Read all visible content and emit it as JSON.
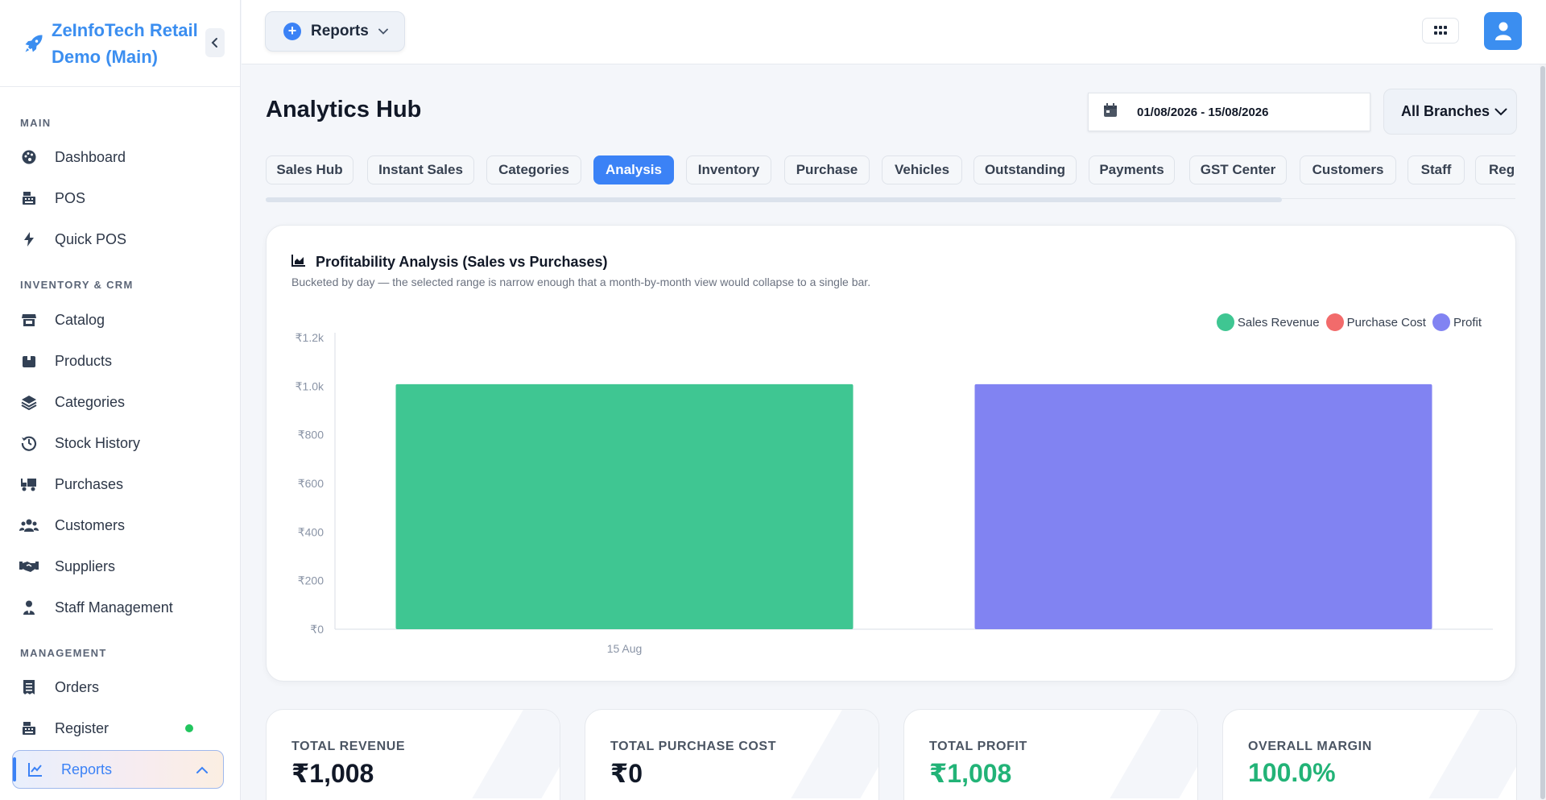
{
  "brand": {
    "name": "ZeInfoTech Retail Demo (Main)"
  },
  "sidebar": {
    "sections": [
      {
        "label": "MAIN",
        "items": [
          {
            "label": "Dashboard",
            "icon": "palette-icon"
          },
          {
            "label": "POS",
            "icon": "cash-register-icon"
          },
          {
            "label": "Quick POS",
            "icon": "bolt-icon"
          }
        ]
      },
      {
        "label": "INVENTORY & CRM",
        "items": [
          {
            "label": "Catalog",
            "icon": "store-icon"
          },
          {
            "label": "Products",
            "icon": "box-icon"
          },
          {
            "label": "Categories",
            "icon": "layers-icon"
          },
          {
            "label": "Stock History",
            "icon": "history-icon"
          },
          {
            "label": "Purchases",
            "icon": "truck-icon"
          },
          {
            "label": "Customers",
            "icon": "users-icon"
          },
          {
            "label": "Suppliers",
            "icon": "handshake-icon"
          },
          {
            "label": "Staff Management",
            "icon": "user-tie-icon"
          }
        ]
      },
      {
        "label": "MANAGEMENT",
        "items": [
          {
            "label": "Orders",
            "icon": "receipt-icon"
          },
          {
            "label": "Register",
            "icon": "cash-register-icon"
          },
          {
            "label": "Reports",
            "icon": "chart-line-icon"
          }
        ]
      }
    ]
  },
  "topbar": {
    "reports_label": "Reports"
  },
  "page": {
    "title": "Analytics Hub",
    "date_range": "01/08/2026 - 15/08/2026",
    "branch": "All Branches"
  },
  "tabs": [
    "Sales Hub",
    "Instant Sales",
    "Categories",
    "Analysis",
    "Inventory",
    "Purchase",
    "Vehicles",
    "Outstanding",
    "Payments",
    "GST Center",
    "Customers",
    "Staff",
    "Regi"
  ],
  "active_tab": "Analysis",
  "chart": {
    "title": "Profitability Analysis (Sales vs Purchases)",
    "subtitle": "Bucketed by day — the selected range is narrow enough that a month-by-month view would collapse to a single bar."
  },
  "chart_data": {
    "type": "bar",
    "title": "Profitability Analysis (Sales vs Purchases)",
    "categories": [
      "15 Aug"
    ],
    "series": [
      {
        "name": "Sales Revenue",
        "color": "#3fc692",
        "values": [
          1008
        ]
      },
      {
        "name": "Purchase Cost",
        "color": "#f26b6b",
        "values": [
          0
        ]
      },
      {
        "name": "Profit",
        "color": "#8183f2",
        "values": [
          1008
        ]
      }
    ],
    "y_ticks": [
      "₹0",
      "₹200",
      "₹400",
      "₹600",
      "₹800",
      "₹1.0k",
      "₹1.2k"
    ],
    "ylim": [
      0,
      1200
    ],
    "legend_position": "top-right",
    "grid": false
  },
  "stats": [
    {
      "label": "TOTAL REVENUE",
      "value": "₹1,008",
      "color": "#111827"
    },
    {
      "label": "TOTAL PURCHASE COST",
      "value": "₹0",
      "color": "#111827"
    },
    {
      "label": "TOTAL PROFIT",
      "value": "₹1,008",
      "color": "#22b377"
    },
    {
      "label": "OVERALL MARGIN",
      "value": "100.0%",
      "color": "#22b377"
    }
  ]
}
